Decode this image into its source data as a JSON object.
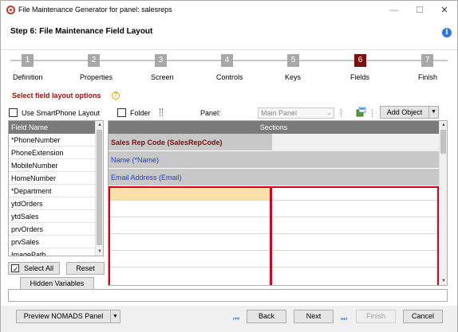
{
  "window": {
    "title": "File Maintenance Generator for panel: salesreps",
    "minimize": "—",
    "maximize": "☐",
    "close": "✕"
  },
  "header": {
    "step_title": "Step 6: File Maintenance Field Layout",
    "info_icon": "i"
  },
  "steps": [
    {
      "num": "1",
      "label": "Definition"
    },
    {
      "num": "2",
      "label": "Properties"
    },
    {
      "num": "3",
      "label": "Screen"
    },
    {
      "num": "4",
      "label": "Controls"
    },
    {
      "num": "5",
      "label": "Keys"
    },
    {
      "num": "6",
      "label": "Fields",
      "active": true
    },
    {
      "num": "7",
      "label": "Finish"
    }
  ],
  "options": {
    "title": "Select field layout options",
    "help_icon": "?",
    "use_smartphone_label": "Use SmartPhone Layout",
    "folder_label": "Folder",
    "panel_label": "Panel:",
    "panel_value": "Main Panel",
    "add_object_label": "Add Object",
    "dropdown_arrow": "▼"
  },
  "field_list": {
    "header": "Field Name",
    "items": [
      "*PhoneNumber",
      "PhoneExtension",
      "MobileNumber",
      "HomeNumber",
      "*Department",
      "ytdOrders",
      "ytdSales",
      "prvOrders",
      "prvSales",
      "ImagePath"
    ]
  },
  "field_buttons": {
    "select_all": "Select All",
    "reset": "Reset",
    "hidden_variables": "Hidden Variables"
  },
  "sections": {
    "header": "Sections",
    "rows": [
      {
        "text": "Sales Rep Code (SalesRepCode)",
        "style": "bold"
      },
      {
        "text": "Name (*Name)",
        "style": "blue"
      },
      {
        "text": "Email Address (Email)",
        "style": "blue"
      }
    ]
  },
  "footer": {
    "preview": "Preview NOMADS Panel",
    "back": "Back",
    "next": "Next",
    "finish": "Finish",
    "cancel": "Cancel"
  },
  "colors": {
    "active_step": "#7b1010",
    "red_outline": "#d8001c",
    "highlight": "#fce0ab"
  }
}
